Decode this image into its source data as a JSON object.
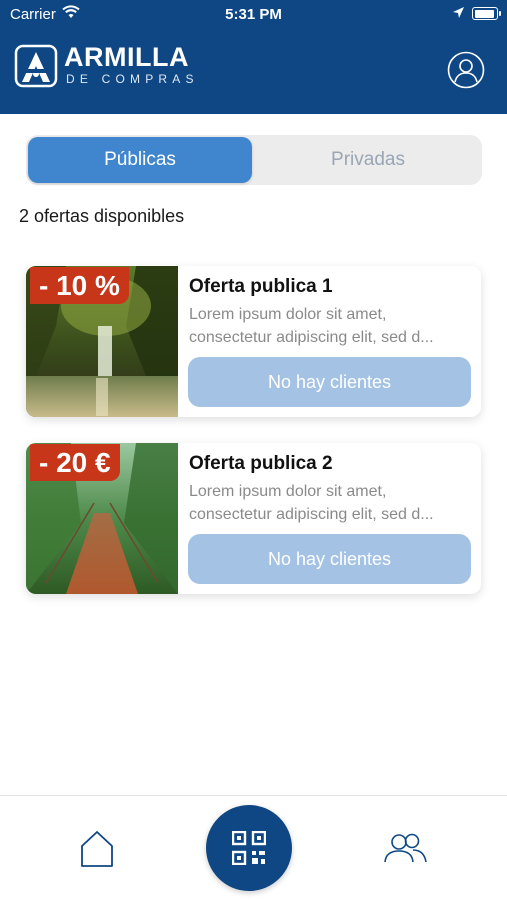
{
  "status_bar": {
    "carrier": "Carrier",
    "time": "5:31 PM",
    "battery_level": 0.95
  },
  "header": {
    "brand_title": "ARMILLA",
    "brand_subtitle": "DE COMPRAS",
    "brand_color": "#0f4784"
  },
  "segmented": {
    "options": [
      {
        "label": "Públicas",
        "selected": true
      },
      {
        "label": "Privadas",
        "selected": false
      }
    ]
  },
  "offers_count": "2 ofertas disponibles",
  "offers": [
    {
      "badge": "- 10 %",
      "title": "Oferta publica 1",
      "description_line1": "Lorem ipsum dolor sit amet,",
      "description_line2": "consectetur adipiscing elit, sed d...",
      "button": "No hay clientes",
      "image": "waterfall-forest"
    },
    {
      "badge": "- 20 €",
      "title": "Oferta publica 2",
      "description_line1": "Lorem ipsum dolor sit amet,",
      "description_line2": "consectetur adipiscing elit, sed d...",
      "button": "No hay clientes",
      "image": "jungle-bridge"
    }
  ],
  "tabbar": {
    "items": [
      "home-icon",
      "qr-code-icon",
      "users-icon"
    ]
  }
}
